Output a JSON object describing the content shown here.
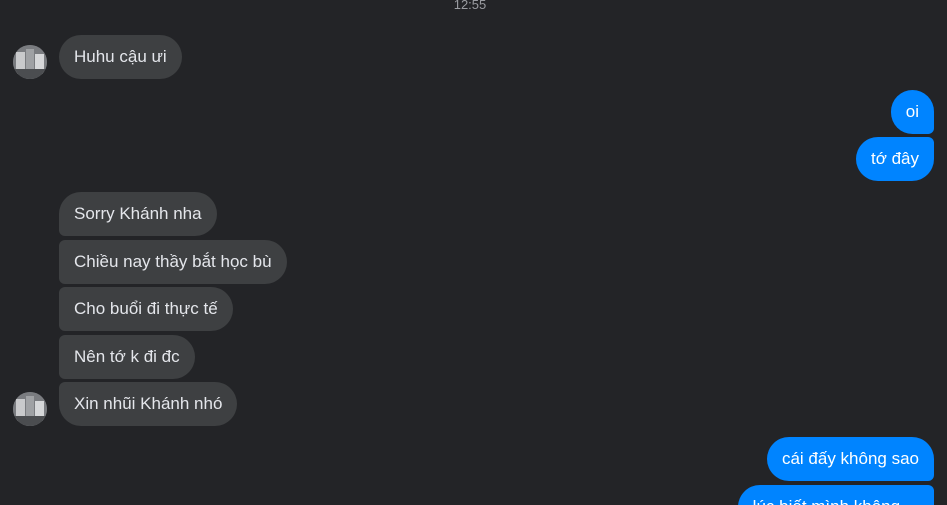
{
  "timestamp": "12:55",
  "incoming": [
    "Huhu cậu ưi",
    "Sorry Khánh nha",
    "Chiều nay thầy bắt học bù",
    "Cho buổi đi thực tế",
    "Nên tớ k đi đc",
    "Xin nhũi Khánh nhó"
  ],
  "outgoing": [
    "oi",
    "tớ đây",
    "cái đấy không sao",
    "lúc biết mình không ..."
  ],
  "colors": {
    "background": "#232427",
    "incoming_bubble": "#3e4042",
    "outgoing_bubble": "#0084ff"
  }
}
